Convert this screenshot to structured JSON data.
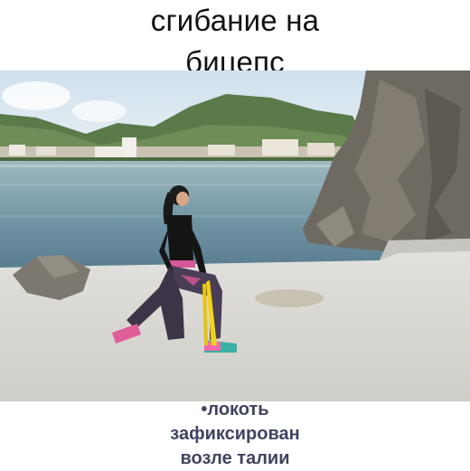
{
  "title": {
    "line1": "сгибание на",
    "line2": "бицепс"
  },
  "caption": {
    "line1": "•локоть",
    "line2": "зафиксирован",
    "line3": "возле талии"
  },
  "colors": {
    "title_text": "#111111",
    "caption_text": "#3f4460",
    "sky": "#dfe9f2",
    "water": "#6f93a3",
    "concrete": "#dad9d6",
    "rock": "#6e6a62",
    "band": "#f1d31c"
  }
}
